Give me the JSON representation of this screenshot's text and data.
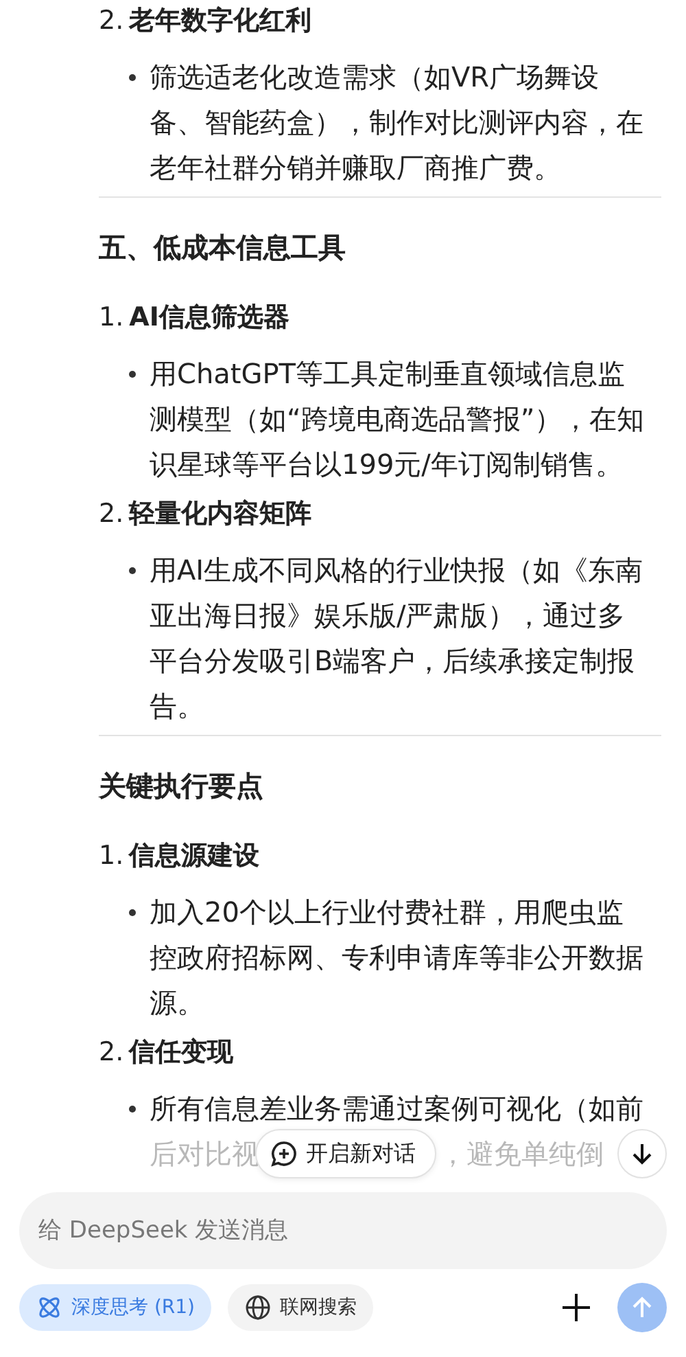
{
  "sections": [
    {
      "items": [
        {
          "number": "2.",
          "title": "老年数字化红利",
          "bullets": [
            "筛选适老化改造需求（如VR广场舞设备、智能药盒），制作对比测评内容，在老年社群分销并赚取厂商推广费。"
          ]
        }
      ]
    },
    {
      "heading": "五、低成本信息工具",
      "items": [
        {
          "number": "1.",
          "title": "AI信息筛选器",
          "bullets": [
            "用ChatGPT等工具定制垂直领域信息监测模型（如“跨境电商选品警报”），在知识星球等平台以199元/年订阅制销售。"
          ]
        },
        {
          "number": "2.",
          "title": "轻量化内容矩阵",
          "bullets": [
            "用AI生成不同风格的行业快报（如《东南亚出海日报》娱乐版/严肃版），通过多平台分发吸引B端客户，后续承接定制报告。"
          ]
        }
      ]
    },
    {
      "heading": "关键执行要点",
      "items": [
        {
          "number": "1.",
          "title": "信息源建设",
          "bullets": [
            "加入20个以上行业付费社群，用爬虫监控政府招标网、专利申请库等非公开数据源。"
          ]
        },
        {
          "number": "2.",
          "title": "信任变现",
          "bullets": [
            "所有信息差业务需通过案例可视化（如前"
          ],
          "cut_line": [
            "后对比视",
            "，避免单纯倒"
          ]
        }
      ]
    }
  ],
  "new_chat_button": {
    "label": "开启新对话"
  },
  "input": {
    "placeholder": "给 DeepSeek 发送消息"
  },
  "toggles": [
    {
      "label": "深度思考 (R1)",
      "kind": "think",
      "selected": true
    },
    {
      "label": "联网搜索",
      "kind": "web",
      "selected": false
    }
  ],
  "send_disabled": true
}
